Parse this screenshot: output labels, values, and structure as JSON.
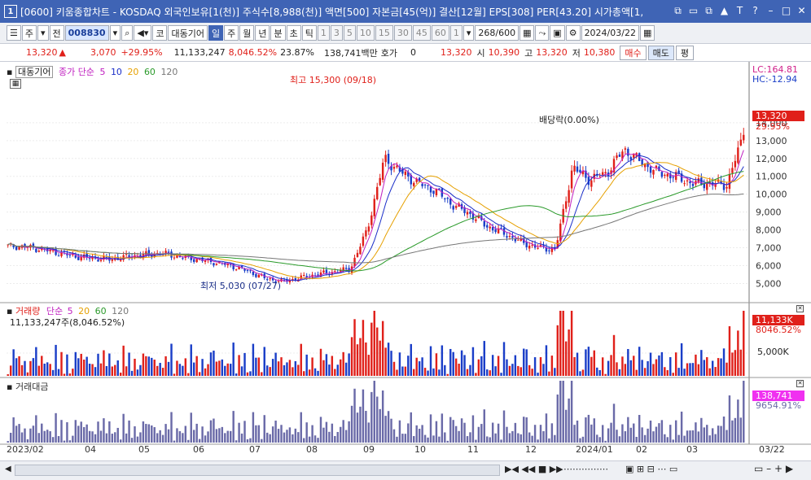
{
  "window": {
    "number": "1",
    "title": "[0600] 키움종합차트 - KOSDAQ 외국인보유[1(천)] 주식수[8,988(천)] 액면[500] 자본금[45(억)] 결산[12월] EPS[308] PER[43.20] 시가총액[1,",
    "controls": [
      "⧉",
      "▭",
      "⧉",
      "▲",
      "T",
      "?",
      "–",
      "□",
      "✕"
    ]
  },
  "toolbar": {
    "type_label": "주",
    "mode_label": "전",
    "code_value": "008830",
    "search_icon": "search-icon",
    "speaker_icon": "speaker-icon",
    "market_label": "코",
    "name_label": "대동기어",
    "periods": [
      "일",
      "주",
      "월",
      "년",
      "분",
      "초",
      "틱"
    ],
    "selected_period": "일",
    "intervals": [
      "1",
      "3",
      "5",
      "10",
      "15",
      "30",
      "45",
      "60"
    ],
    "interval_select": "1",
    "count_value": "268",
    "count_total": "/600",
    "date_value": "2024/03/22"
  },
  "quote": {
    "price": "13,320",
    "change": "3,070",
    "change_pct": "+29.95%",
    "volume": "11,133,247",
    "volume_pct": "8,046.52%",
    "turnover": "23.87%",
    "amount": "138,741백만",
    "ask_label": "호가",
    "ask_value": "0",
    "ask_price": "13,320",
    "open_label": "시",
    "open_value": "10,390",
    "high_label": "고",
    "high_value": "13,320",
    "low_label": "저",
    "low_value": "10,380",
    "buy_label": "매수",
    "sell_label": "매도",
    "flat_label": "평"
  },
  "price_panel": {
    "legend_name": "대동기어",
    "legend_ma": "종가 단순",
    "ma_periods": [
      "5",
      "10",
      "20",
      "60",
      "120"
    ],
    "ma_colors": [
      "#c020c0",
      "#1a2ec8",
      "#e6a000",
      "#2a9a2a",
      "#777777"
    ],
    "lc_label": "LC:164.81",
    "hc_label": "HC:-12.94",
    "current_badge": "13,320",
    "current_pct": "29.95%",
    "high_annotation": "최고 15,300 (09/18)",
    "low_annotation": "최저 5,030 (07/27)",
    "dividend_annotation": "배당락(0.00%)"
  },
  "volume_panel": {
    "legend": "거래량",
    "legend_ma": "단순",
    "ma_periods": [
      "5",
      "20",
      "60",
      "120"
    ],
    "current_text": "11,133,247주(8,046.52%)",
    "current_badge": "11,133K",
    "current_pct": "8046.52%"
  },
  "amount_panel": {
    "legend": "거래대금",
    "current_badge": "138,741",
    "current_pct": "9654.91%"
  },
  "date_axis": [
    "2023/02",
    "04",
    "05",
    "06",
    "07",
    "08",
    "09",
    "10",
    "11",
    "12",
    "2024/01",
    "02",
    "03",
    "03/22"
  ],
  "colors": {
    "up": "#e0201a",
    "down": "#1a3ec8",
    "accent": "#3f64b5",
    "amount": "#6a6aa8"
  },
  "chart_data": {
    "type": "line",
    "title": "",
    "price_ticks": [
      5000,
      6000,
      7000,
      8000,
      9000,
      10000,
      11000,
      12000,
      13000,
      14000
    ],
    "volume_ticks": [
      "5,000K"
    ],
    "ylim": [
      4200,
      16500
    ],
    "series": [
      {
        "values": [
          7100,
          7050,
          6900,
          6700,
          6500,
          6400,
          6350,
          6500,
          6600,
          6700,
          6500,
          6350,
          6200,
          6000,
          5700,
          5300,
          5100,
          5300,
          5500,
          5650,
          5800,
          8000,
          12000,
          11200,
          10600,
          10200,
          9400,
          8900,
          8200,
          7800,
          7300,
          7000,
          6900,
          11500,
          10800,
          11200,
          12500,
          11800,
          11200,
          11000,
          10600,
          10600,
          10500,
          13320
        ]
      }
    ]
  }
}
